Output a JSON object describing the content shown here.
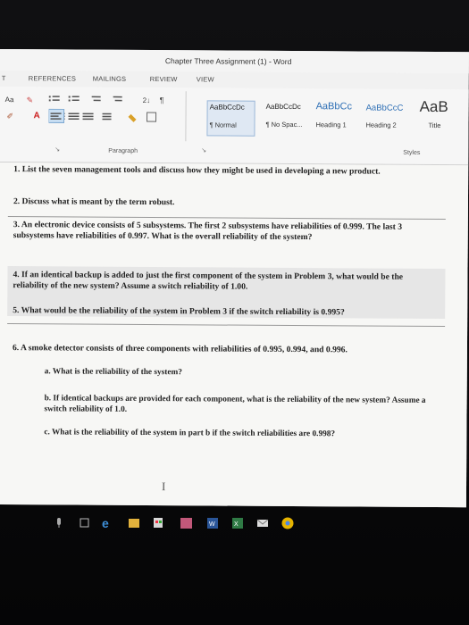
{
  "window": {
    "title": "Chapter Three Assignment (1) - Word"
  },
  "tabs": [
    "T",
    "REFERENCES",
    "MAILINGS",
    "REVIEW",
    "VIEW"
  ],
  "ribbon": {
    "font_size_btn": "Aa",
    "styles": [
      {
        "sample": "AaBbCcDc",
        "name": "¶ Normal"
      },
      {
        "sample": "AaBbCcDc",
        "name": "¶ No Spac..."
      },
      {
        "sample": "AaBbCc",
        "name": "Heading 1"
      },
      {
        "sample": "AaBbCcC",
        "name": "Heading 2"
      },
      {
        "sample": "AaB",
        "name": "Title"
      }
    ],
    "groups": {
      "paragraph": "Paragraph",
      "styles": "Styles"
    }
  },
  "document": {
    "q1": "1. List the seven management tools and discuss how they might be used in developing a new product.",
    "q2": "2. Discuss what is meant by the term robust.",
    "q3": "3. An electronic device consists of 5 subsystems. The first 2 subsystems have reliabilities of 0.999. The last 3 subsystems have reliabilities of 0.997. What is the overall reliability of the system?",
    "q4": "4. If an identical backup is added to just the first component of the system in Problem 3, what would be the reliability of the new system? Assume a switch reliability of 1.00.",
    "q5": "5. What would be the reliability of the system in Problem 3 if the switch reliability is 0.995?",
    "q6": "6. A smoke detector consists of three components with reliabilities of 0.995, 0.994, and 0.996.",
    "q6a": "a. What is the reliability of the system?",
    "q6b": "b. If identical backups are provided for each component, what is the reliability of the new system? Assume a switch reliability of 1.0.",
    "q6c": "c. What is the reliability of the system in part b if the switch reliabilities are 0.998?"
  },
  "taskbar": {
    "icons": [
      "mic-icon",
      "task-view-icon",
      "edge-icon",
      "file-explorer-icon",
      "store-icon",
      "photos-icon",
      "word-icon",
      "excel-icon",
      "mail-icon",
      "chrome-icon"
    ]
  }
}
